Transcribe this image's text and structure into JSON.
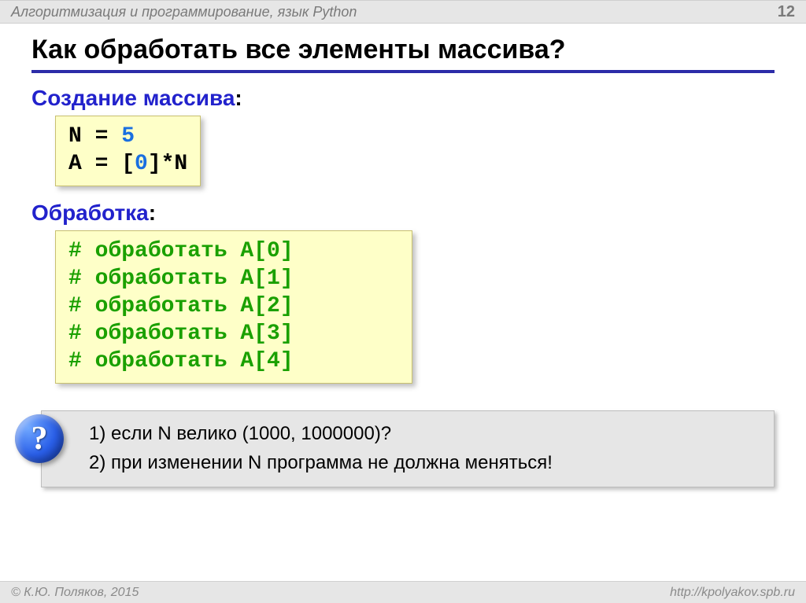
{
  "header": {
    "course": "Алгоритмизация и программирование, язык Python",
    "page": "12"
  },
  "title": "Как обработать все элементы массива?",
  "sections": {
    "create_label": "Создание массива",
    "process_label": "Обработка"
  },
  "code1": {
    "l1_a": "N = ",
    "l1_b": "5",
    "l2_a": "A = [",
    "l2_b": "0",
    "l2_c": "]*N"
  },
  "code2": {
    "lines": [
      "# обработать A[0]",
      "# обработать A[1]",
      "# обработать A[2]",
      "# обработать A[3]",
      "# обработать A[4]"
    ]
  },
  "question": {
    "mark": "?",
    "line1": "1) если N велико (1000, 1000000)?",
    "line2": "2) при изменении N программа не должна меняться!"
  },
  "footer": {
    "copyright": "© К.Ю. Поляков, 2015",
    "url": "http://kpolyakov.spb.ru"
  }
}
